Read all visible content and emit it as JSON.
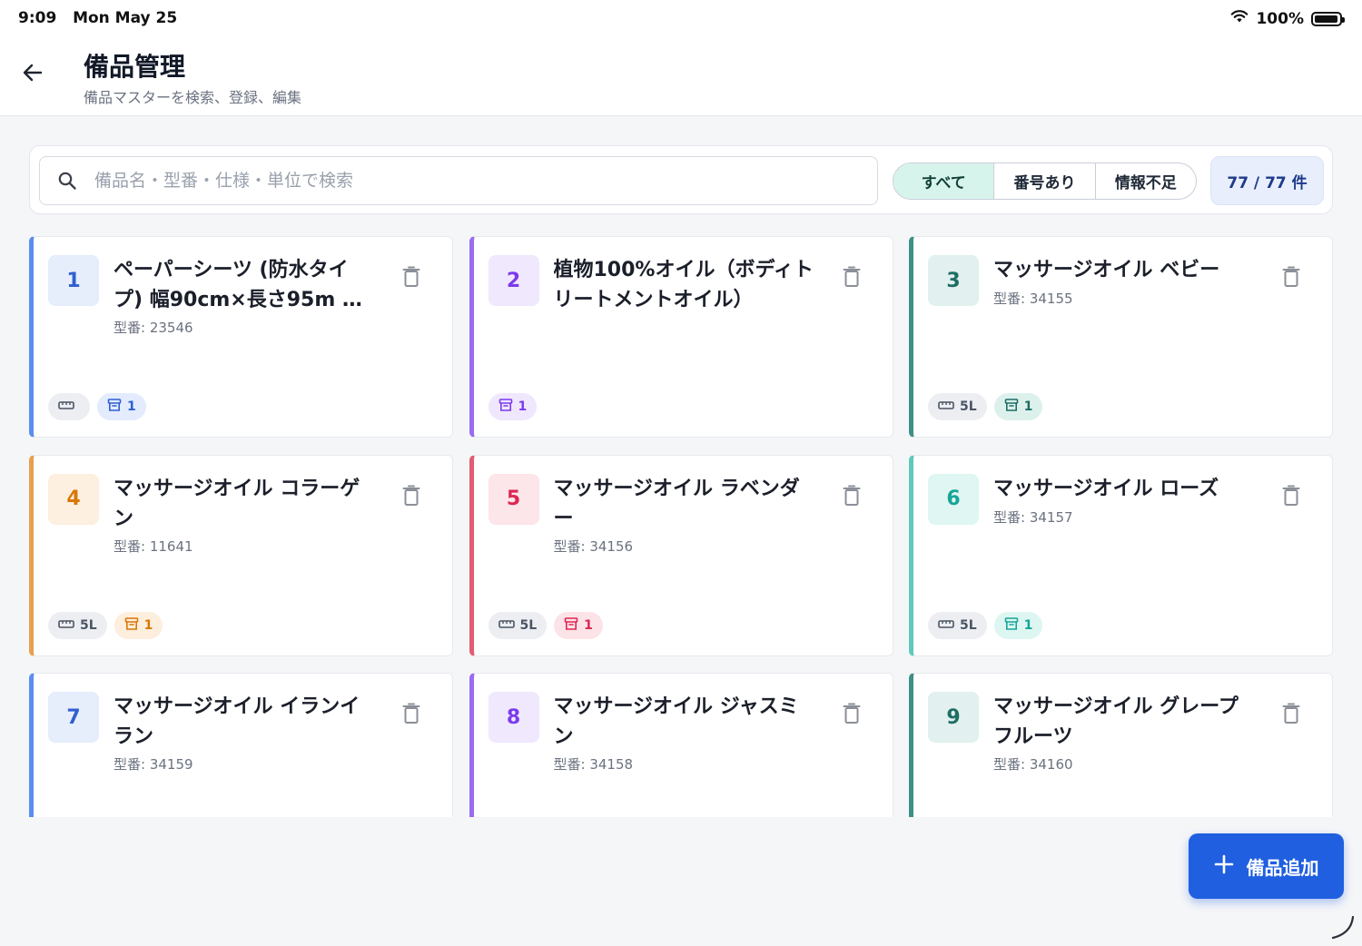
{
  "status_bar": {
    "time": "9:09",
    "date": "Mon May 25",
    "battery": "100%",
    "battery_level": 0.97,
    "icons": [
      "wifi-icon",
      "battery-icon"
    ]
  },
  "header": {
    "back_icon": "arrow-left-icon",
    "title": "備品管理",
    "subtitle": "備品マスターを検索、登録、編集"
  },
  "search": {
    "placeholder": "備品名・型番・仕様・単位で検索",
    "value": "",
    "icon": "search-icon"
  },
  "filters": [
    {
      "label": "すべて",
      "active": true
    },
    {
      "label": "番号あり",
      "active": false
    },
    {
      "label": "情報不足",
      "active": false
    }
  ],
  "count_label": "77 / 77 件",
  "cards": [
    {
      "number": "1",
      "title": "ペーパーシーツ (防水タイプ) 幅90cm×長さ95m …",
      "model": "型番: 23546",
      "spec": "",
      "qty": "1",
      "accent": "#5b8def",
      "badge_bg": "#e6eefc",
      "badge_fg": "#2f5fd0",
      "chip_bg": "#e3ebfd",
      "chip_fg": "#2f5fd0"
    },
    {
      "number": "2",
      "title": "植物100%オイル（ボディトリートメントオイル）",
      "model": "",
      "spec": null,
      "qty": "1",
      "accent": "#9b6cf0",
      "badge_bg": "#f0e9fd",
      "badge_fg": "#7c3aed",
      "chip_bg": "#efe7fd",
      "chip_fg": "#7c3aed"
    },
    {
      "number": "3",
      "title": "マッサージオイル ベビー",
      "model": "型番: 34155",
      "spec": "5L",
      "qty": "1",
      "accent": "#3f8f86",
      "badge_bg": "#e2f1ef",
      "badge_fg": "#1f6e66",
      "chip_bg": "#ddf1ec",
      "chip_fg": "#1f6e66"
    },
    {
      "number": "4",
      "title": "マッサージオイル コラーゲン",
      "model": "型番: 11641",
      "spec": "5L",
      "qty": "1",
      "accent": "#e8a04f",
      "badge_bg": "#fdf0e1",
      "badge_fg": "#d97706",
      "chip_bg": "#fdeedd",
      "chip_fg": "#d97706"
    },
    {
      "number": "5",
      "title": "マッサージオイル ラベンダー",
      "model": "型番: 34156",
      "spec": "5L",
      "qty": "1",
      "accent": "#e25d73",
      "badge_bg": "#fce6ea",
      "badge_fg": "#db2750",
      "chip_bg": "#fce3e8",
      "chip_fg": "#db2750"
    },
    {
      "number": "6",
      "title": "マッサージオイル ローズ",
      "model": "型番: 34157",
      "spec": "5L",
      "qty": "1",
      "accent": "#5fc9bd",
      "badge_bg": "#e0f6f2",
      "badge_fg": "#17a598",
      "chip_bg": "#ddf6f1",
      "chip_fg": "#17a598"
    },
    {
      "number": "7",
      "title": "マッサージオイル イランイラン",
      "model": "型番: 34159",
      "spec": null,
      "qty": null,
      "accent": "#5b8def",
      "badge_bg": "#e6eefc",
      "badge_fg": "#2f5fd0",
      "chip_bg": "#e3ebfd",
      "chip_fg": "#2f5fd0"
    },
    {
      "number": "8",
      "title": "マッサージオイル ジャスミン",
      "model": "型番: 34158",
      "spec": null,
      "qty": null,
      "accent": "#9b6cf0",
      "badge_bg": "#f0e9fd",
      "badge_fg": "#7c3aed",
      "chip_bg": "#efe7fd",
      "chip_fg": "#7c3aed"
    },
    {
      "number": "9",
      "title": "マッサージオイル グレープフルーツ",
      "model": "型番: 34160",
      "spec": null,
      "qty": null,
      "accent": "#3f8f86",
      "badge_bg": "#e2f1ef",
      "badge_fg": "#1f6e66",
      "chip_bg": "#ddf1ec",
      "chip_fg": "#1f6e66"
    }
  ],
  "fab": {
    "label": "備品追加",
    "icon": "plus-icon"
  }
}
